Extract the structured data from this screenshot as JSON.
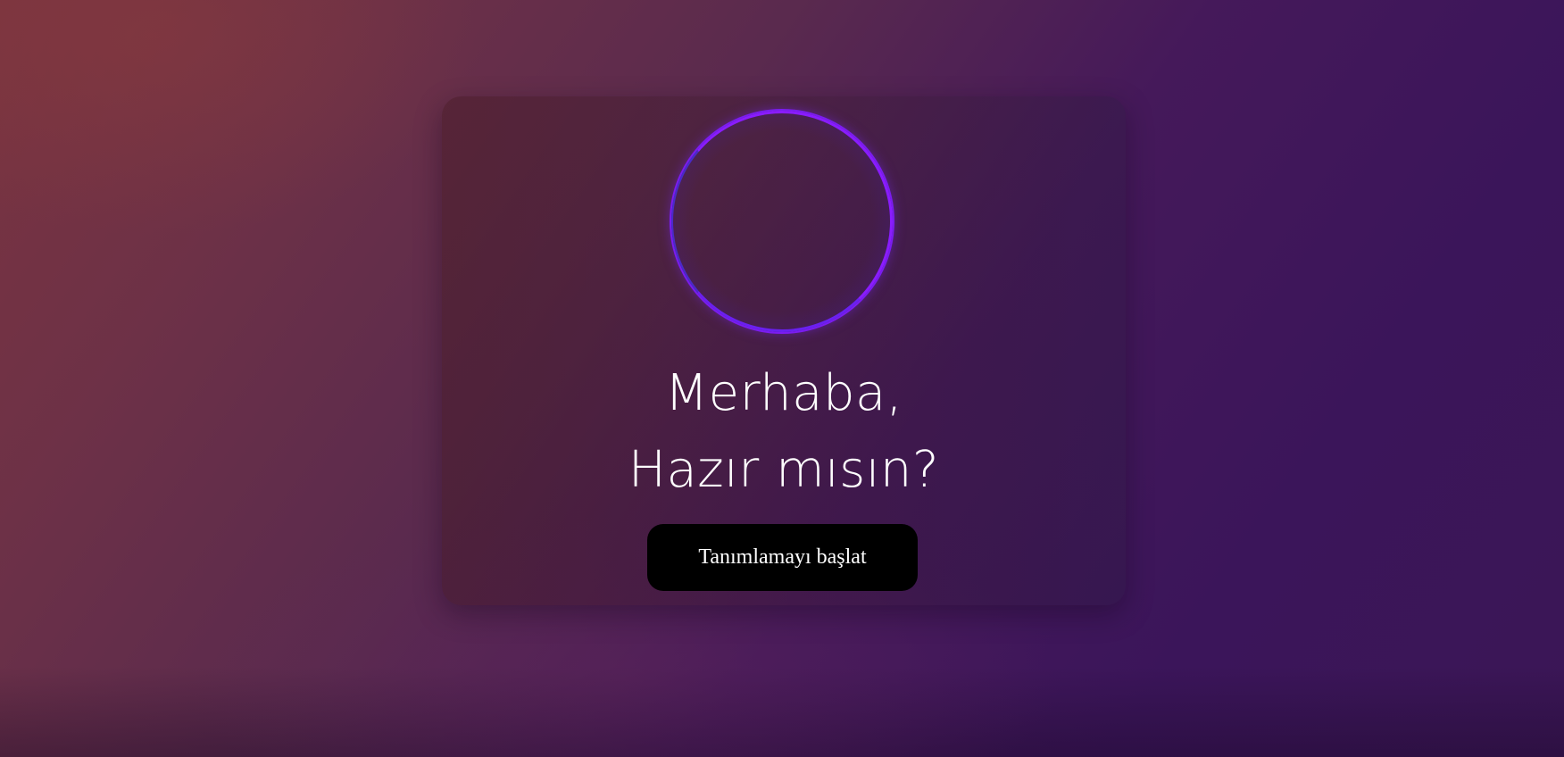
{
  "greeting": {
    "line1": "Merhaba,",
    "line2": "Hazır mısın?"
  },
  "actions": {
    "start_label": "Tanımlamayı başlat"
  },
  "colors": {
    "orb_ring": "#7b1cf0",
    "button_bg": "#000000",
    "text": "#ffffff"
  },
  "icons": {
    "orb": "voice-orb-icon"
  }
}
